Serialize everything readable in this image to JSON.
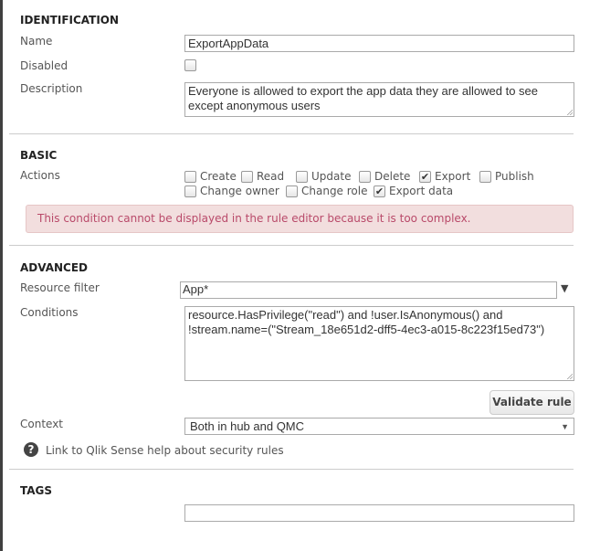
{
  "identification": {
    "title": "IDENTIFICATION",
    "name_label": "Name",
    "name_value": "ExportAppData",
    "disabled_label": "Disabled",
    "disabled": false,
    "description_label": "Description",
    "description_value": "Everyone is allowed to export the app data they are allowed to see except anonymous users"
  },
  "basic": {
    "title": "BASIC",
    "actions_label": "Actions",
    "actions": [
      {
        "label": "Create",
        "checked": false
      },
      {
        "label": "Read",
        "checked": false
      },
      {
        "label": "Update",
        "checked": false
      },
      {
        "label": "Delete",
        "checked": false
      },
      {
        "label": "Export",
        "checked": true
      },
      {
        "label": "Publish",
        "checked": false
      },
      {
        "label": "Change owner",
        "checked": false
      },
      {
        "label": "Change role",
        "checked": false
      },
      {
        "label": "Export data",
        "checked": true
      }
    ],
    "warning": "This condition cannot be displayed in the rule editor because it is too complex.",
    "warning_color": "#f2dede"
  },
  "advanced": {
    "title": "ADVANCED",
    "resource_filter_label": "Resource filter",
    "resource_filter_value": "App*",
    "conditions_label": "Conditions",
    "conditions_value": "resource.HasPrivilege(\"read\") and !user.IsAnonymous() and !stream.name=(\"Stream_18e651d2-dff5-4ec3-a015-8c223f15ed73\")",
    "validate_label": "Validate rule",
    "context_label": "Context",
    "context_value": "Both in hub and QMC",
    "help_link": "Link to Qlik Sense help about security rules"
  },
  "tags": {
    "title": "TAGS",
    "value": ""
  }
}
